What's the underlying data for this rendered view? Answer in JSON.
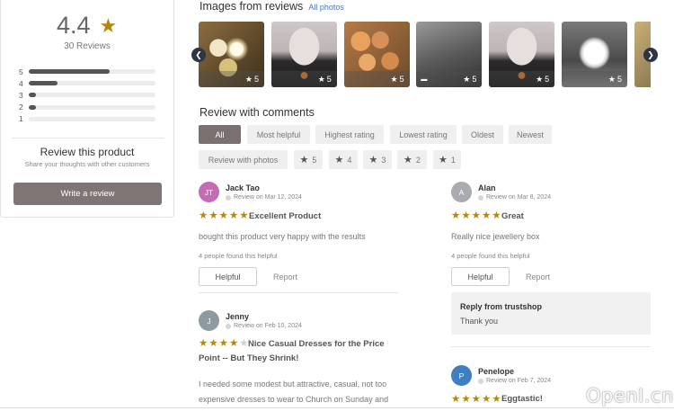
{
  "summary": {
    "average": "4.4",
    "total": "30 Reviews",
    "distribution": [
      {
        "label": "5",
        "fraction": 0.64
      },
      {
        "label": "4",
        "fraction": 0.23
      },
      {
        "label": "3",
        "fraction": 0.06
      },
      {
        "label": "2",
        "fraction": 0.06
      },
      {
        "label": "1",
        "fraction": 0.0
      }
    ],
    "review_heading": "Review this product",
    "review_subtext": "Share your thoughts with other customers",
    "write_button": "Write a review"
  },
  "images": {
    "title": "Images from reviews",
    "all_link": "All photos",
    "thumbs": [
      {
        "rating": "5",
        "has_video": false
      },
      {
        "rating": "5",
        "has_video": false
      },
      {
        "rating": "5",
        "has_video": false
      },
      {
        "rating": "5",
        "has_video": true
      },
      {
        "rating": "5",
        "has_video": false
      },
      {
        "rating": "5",
        "has_video": false
      },
      {
        "rating": "",
        "has_video": false
      }
    ]
  },
  "comments": {
    "title": "Review with comments",
    "filters": [
      "All",
      "Most helpful",
      "Highest rating",
      "Lowest rating",
      "Oldest",
      "Newest"
    ],
    "filters_row2": [
      "Review with photos",
      "5",
      "4",
      "3",
      "2",
      "1"
    ]
  },
  "reviews": [
    {
      "initials": "JT",
      "name": "Jack Tao",
      "date": "Review on Mar 12, 2024",
      "rating": 5,
      "title": "Excellent Product",
      "body": "bought this product very happy with the results",
      "helpful_count": "4 people found this helpful",
      "helpful_btn": "Helpful",
      "report": "Report",
      "avatar_color": "#c56bb4"
    },
    {
      "initials": "A",
      "name": "Alan",
      "date": "Review on Mar 8, 2024",
      "rating": 5,
      "title": "Great",
      "body": "Really nice jewellery box",
      "helpful_count": "4 people found this helpful",
      "helpful_btn": "Helpful",
      "report": "Report",
      "avatar_color": "#a9abb0",
      "reply_title": "Reply from trustshop",
      "reply_body": "Thank you"
    },
    {
      "initials": "J",
      "name": "Jenny",
      "date": "Review on Feb 10, 2024",
      "rating": 4,
      "title_line1": "Nice Casual Dresses for the Price",
      "title_line2": "Point -- But They Shrink!",
      "body_line1": "I needed some modest but attractive, casual, not too",
      "body_line2": "expensive dresses to wear to Church on Sunday and",
      "avatar_color": "#8f9aa0"
    },
    {
      "initials": "P",
      "name": "Penelope",
      "date": "Review on Feb 7, 2024",
      "rating": 5,
      "title": "Eggtastic!",
      "avatar_color": "#3f7fc1"
    }
  ],
  "watermark": "OpenI.cn",
  "colors": {
    "star": "#b38a10",
    "button_dark": "#7f7575",
    "link": "#4a76b8"
  }
}
